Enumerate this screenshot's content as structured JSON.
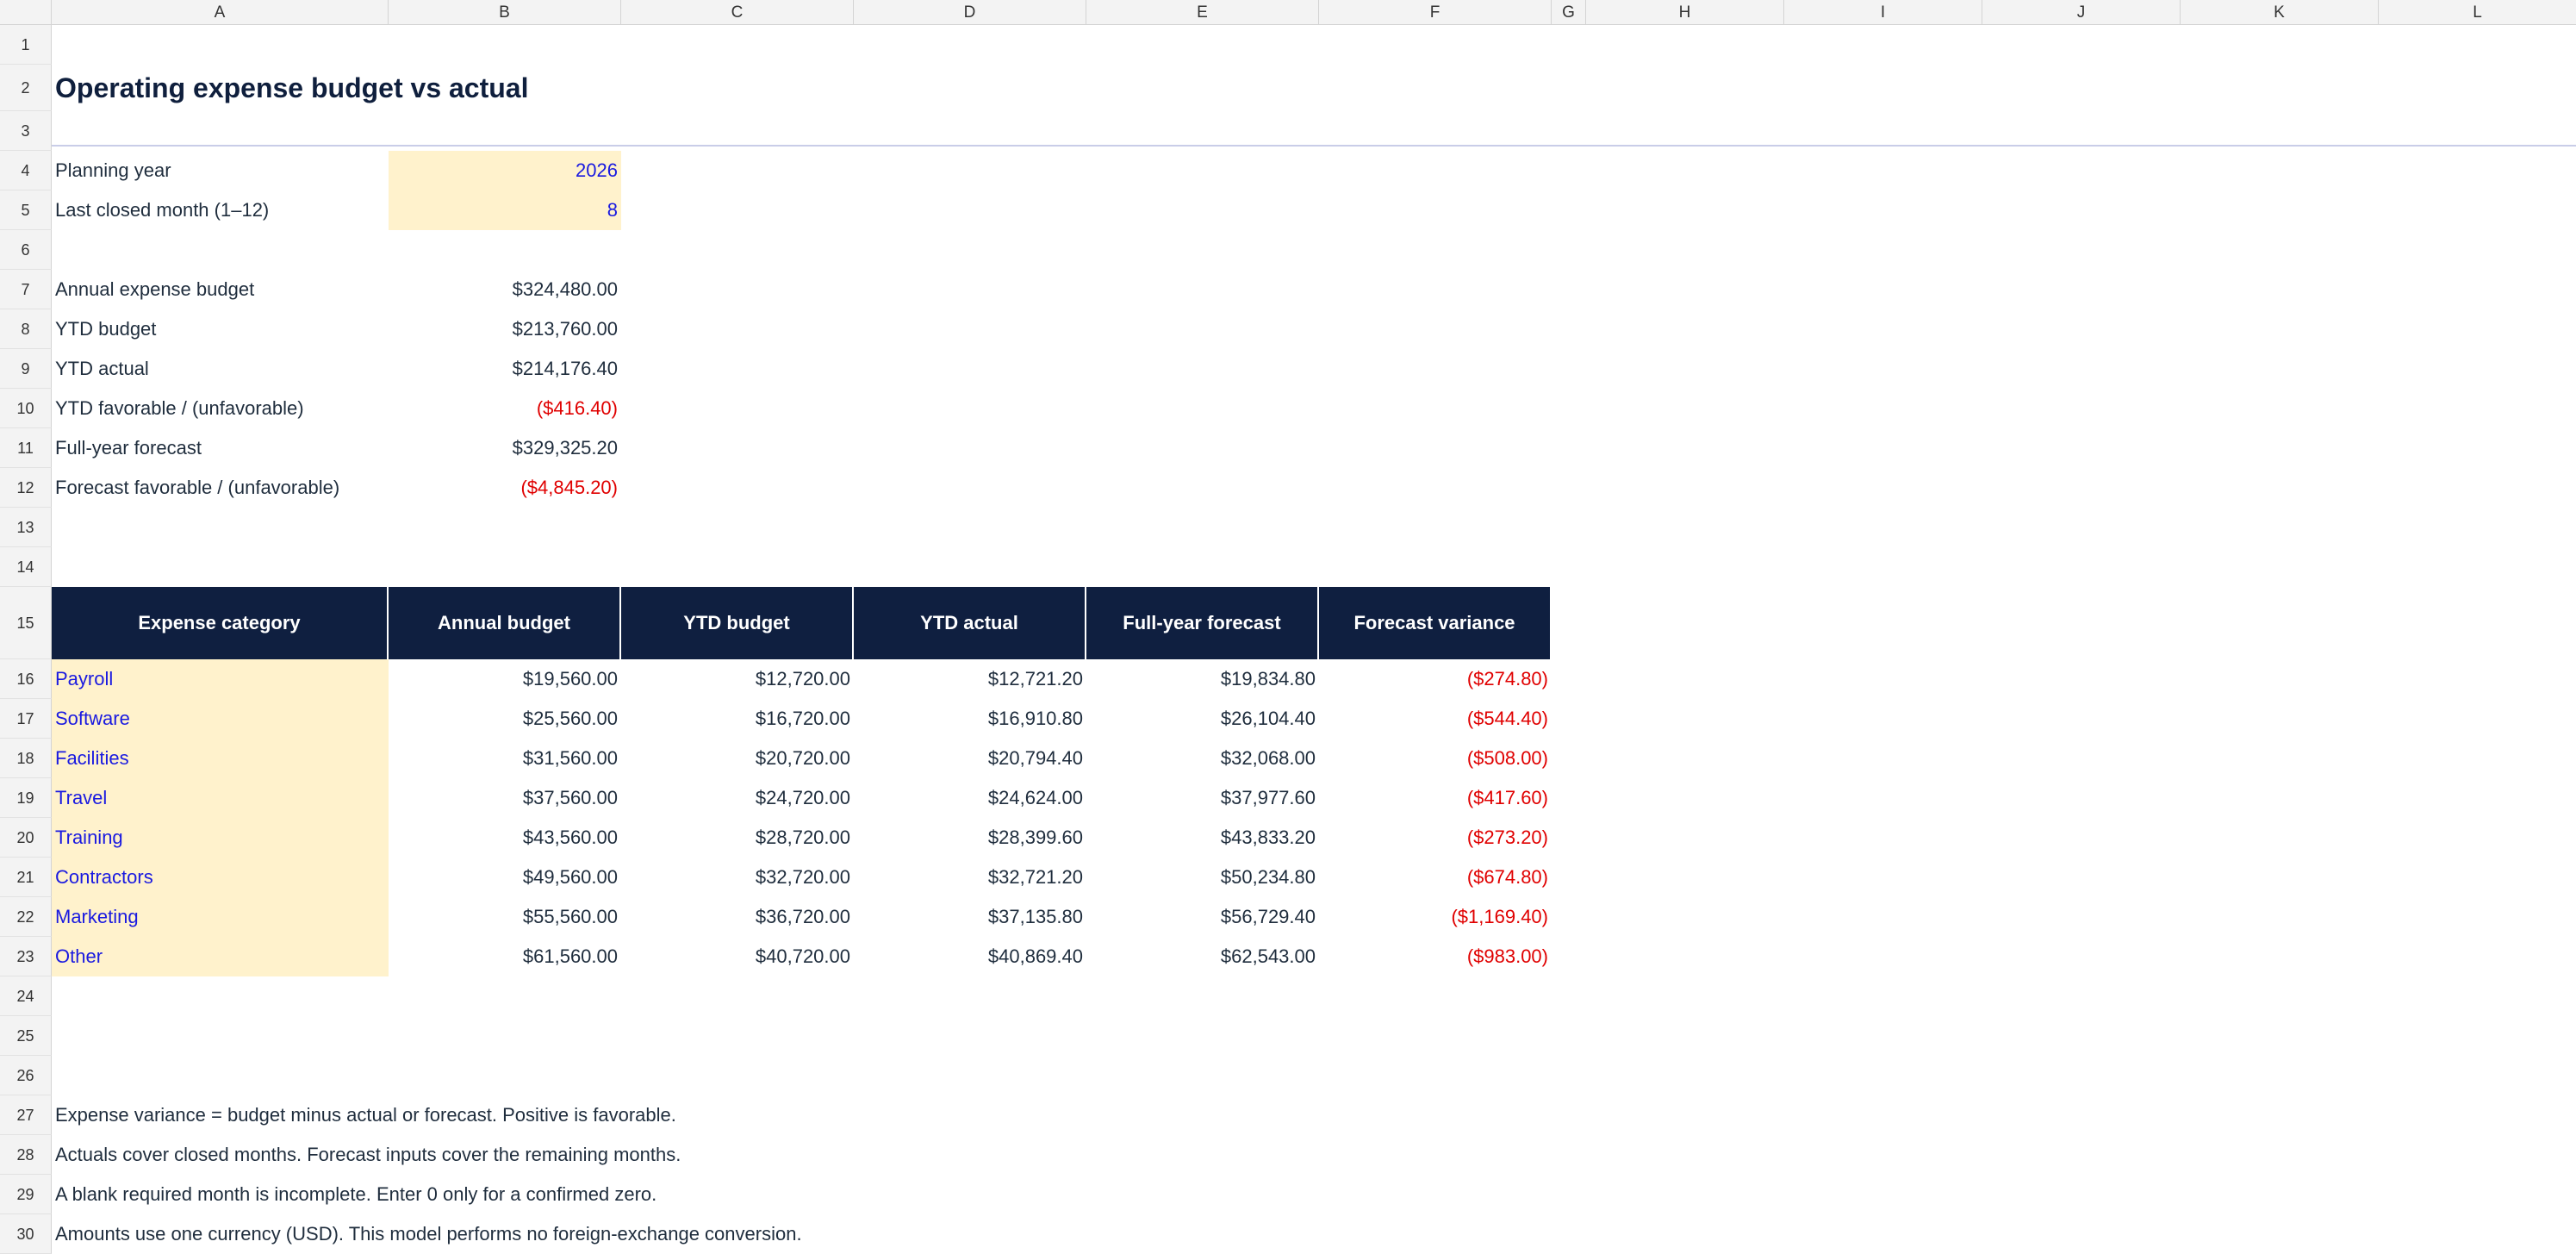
{
  "columns": [
    "A",
    "B",
    "C",
    "D",
    "E",
    "F",
    "G",
    "H",
    "I",
    "J",
    "K",
    "L"
  ],
  "rows": [
    "1",
    "2",
    "3",
    "4",
    "5",
    "6",
    "7",
    "8",
    "9",
    "10",
    "11",
    "12",
    "13",
    "14",
    "15",
    "16",
    "17",
    "18",
    "19",
    "20",
    "21",
    "22",
    "23",
    "24",
    "25",
    "26",
    "27",
    "28",
    "29",
    "30"
  ],
  "title": "Operating expense budget vs actual",
  "inputs": {
    "planning_year_label": "Planning year",
    "planning_year": "2026",
    "last_closed_label": "Last closed month (1–12)",
    "last_closed": "8"
  },
  "summary": [
    {
      "label": "Annual expense budget",
      "value": "$324,480.00",
      "negative": false
    },
    {
      "label": "YTD budget",
      "value": "$213,760.00",
      "negative": false
    },
    {
      "label": "YTD actual",
      "value": "$214,176.40",
      "negative": false
    },
    {
      "label": "YTD favorable / (unfavorable)",
      "value": "($416.40)",
      "negative": true
    },
    {
      "label": "Full-year forecast",
      "value": "$329,325.20",
      "negative": false
    },
    {
      "label": "Forecast favorable / (unfavorable)",
      "value": "($4,845.20)",
      "negative": true
    }
  ],
  "table": {
    "headers": [
      "Expense category",
      "Annual budget",
      "YTD budget",
      "YTD actual",
      "Full-year forecast",
      "Forecast variance"
    ],
    "rows": [
      {
        "category": "Payroll",
        "annual": "$19,560.00",
        "ytd_budget": "$12,720.00",
        "ytd_actual": "$12,721.20",
        "forecast": "$19,834.80",
        "variance": "($274.80)"
      },
      {
        "category": "Software",
        "annual": "$25,560.00",
        "ytd_budget": "$16,720.00",
        "ytd_actual": "$16,910.80",
        "forecast": "$26,104.40",
        "variance": "($544.40)"
      },
      {
        "category": "Facilities",
        "annual": "$31,560.00",
        "ytd_budget": "$20,720.00",
        "ytd_actual": "$20,794.40",
        "forecast": "$32,068.00",
        "variance": "($508.00)"
      },
      {
        "category": "Travel",
        "annual": "$37,560.00",
        "ytd_budget": "$24,720.00",
        "ytd_actual": "$24,624.00",
        "forecast": "$37,977.60",
        "variance": "($417.60)"
      },
      {
        "category": "Training",
        "annual": "$43,560.00",
        "ytd_budget": "$28,720.00",
        "ytd_actual": "$28,399.60",
        "forecast": "$43,833.20",
        "variance": "($273.20)"
      },
      {
        "category": "Contractors",
        "annual": "$49,560.00",
        "ytd_budget": "$32,720.00",
        "ytd_actual": "$32,721.20",
        "forecast": "$50,234.80",
        "variance": "($674.80)"
      },
      {
        "category": "Marketing",
        "annual": "$55,560.00",
        "ytd_budget": "$36,720.00",
        "ytd_actual": "$37,135.80",
        "forecast": "$56,729.40",
        "variance": "($1,169.40)"
      },
      {
        "category": "Other",
        "annual": "$61,560.00",
        "ytd_budget": "$40,720.00",
        "ytd_actual": "$40,869.40",
        "forecast": "$62,543.00",
        "variance": "($983.00)"
      }
    ]
  },
  "notes": [
    "Expense variance = budget minus actual or forecast. Positive is favorable.",
    "Actuals cover closed months. Forecast inputs cover the remaining months.",
    "A blank required month is incomplete. Enter 0 only for a confirmed zero.",
    "Amounts use one currency (USD). This model performs no foreign-exchange conversion."
  ],
  "colors": {
    "header_fill": "#0f1f40",
    "input_fill": "#fff2cc",
    "input_text": "#1a1ae0",
    "negative_text": "#e00000"
  }
}
